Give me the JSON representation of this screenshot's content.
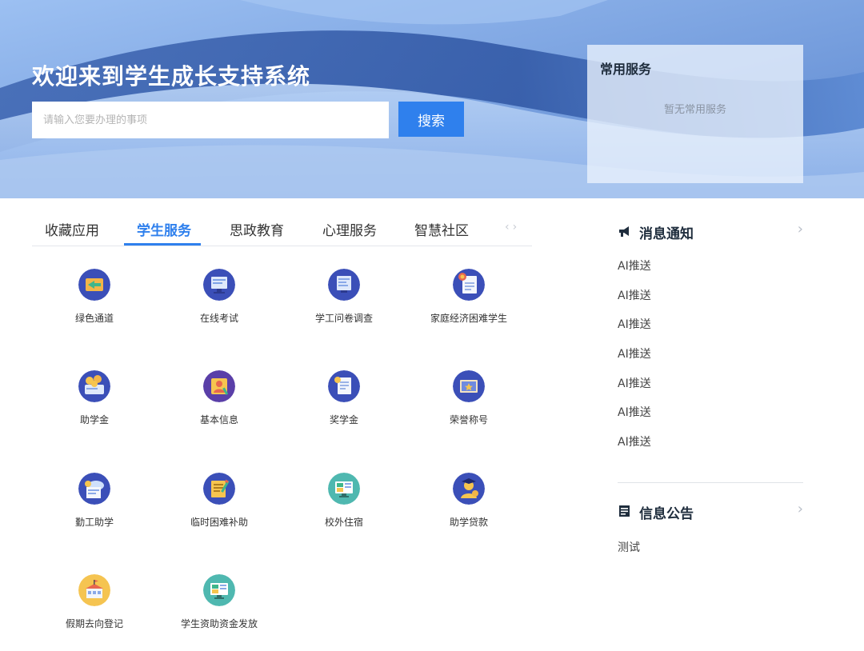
{
  "hero": {
    "title": "欢迎来到学生成长支持系统",
    "search_placeholder": "请输入您要办理的事项",
    "search_button": "搜索"
  },
  "common_services": {
    "title": "常用服务",
    "empty_text": "暂无常用服务"
  },
  "tabs": {
    "items": [
      {
        "label": "收藏应用",
        "active": false
      },
      {
        "label": "学生服务",
        "active": true
      },
      {
        "label": "思政教育",
        "active": false
      },
      {
        "label": "心理服务",
        "active": false
      },
      {
        "label": "智慧社区",
        "active": false
      }
    ],
    "arrows": "‹›"
  },
  "services": [
    {
      "label": "绿色通道",
      "icon": "green-channel-icon",
      "color": "#3b4fb8"
    },
    {
      "label": "在线考试",
      "icon": "online-exam-icon",
      "color": "#3b4fb8"
    },
    {
      "label": "学工问卷调查",
      "icon": "survey-icon",
      "color": "#3b4fb8"
    },
    {
      "label": "家庭经济困难学生",
      "icon": "certificate-icon",
      "color": "#3b4fb8"
    },
    {
      "label": "助学金",
      "icon": "grant-coins-icon",
      "color": "#3b4fb8"
    },
    {
      "label": "基本信息",
      "icon": "profile-icon",
      "color": "#5a3fa8"
    },
    {
      "label": "奖学金",
      "icon": "scholarship-icon",
      "color": "#3b4fb8"
    },
    {
      "label": "荣誉称号",
      "icon": "honor-icon",
      "color": "#3b4fb8"
    },
    {
      "label": "勤工助学",
      "icon": "work-study-icon",
      "color": "#3b4fb8"
    },
    {
      "label": "临时困难补助",
      "icon": "subsidy-icon",
      "color": "#3b4fb8"
    },
    {
      "label": "校外住宿",
      "icon": "off-campus-icon",
      "color": "#4fb8b0"
    },
    {
      "label": "助学贷款",
      "icon": "student-loan-icon",
      "color": "#3b4fb8"
    },
    {
      "label": "假期去向登记",
      "icon": "holiday-register-icon",
      "color": "#f5c451"
    },
    {
      "label": "学生资助资金发放",
      "icon": "funding-payout-icon",
      "color": "#4fb8b0"
    }
  ],
  "notices": {
    "title": "消息通知",
    "items": [
      "AI推送",
      "AI推送",
      "AI推送",
      "AI推送",
      "AI推送",
      "AI推送",
      "AI推送"
    ]
  },
  "announcements": {
    "title": "信息公告",
    "items": [
      "测试"
    ]
  },
  "colors": {
    "accent": "#2f80ed",
    "hero_top": "#7fa9e8",
    "text": "#333333"
  }
}
